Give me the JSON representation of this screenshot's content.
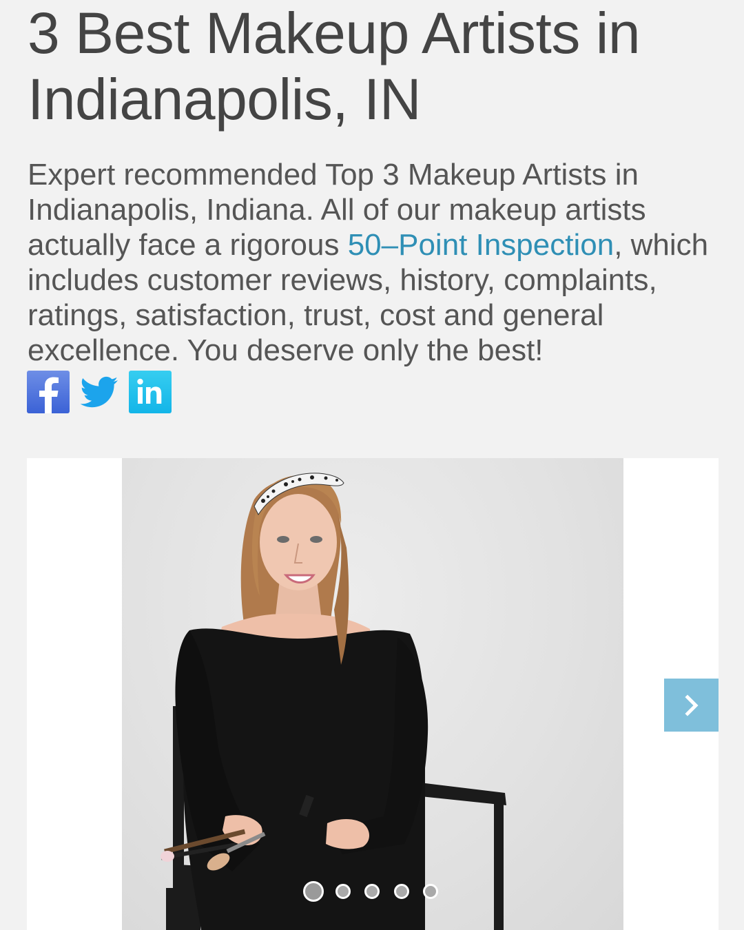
{
  "page": {
    "title": "3 Best Makeup Artists in Indianapolis, IN",
    "intro_before_link": "Expert recommended Top 3 Makeup Artists in Indianapolis, Indiana. All of our makeup artists actually face a rigorous ",
    "intro_link": "50–Point Inspection",
    "intro_after_link": ", which includes customer reviews, history, complaints, ratings, satisfaction, trust, cost and general excellence. You deserve only the best!"
  },
  "social": [
    {
      "name": "facebook",
      "icon": "facebook-icon",
      "color": "#4a6fdc"
    },
    {
      "name": "twitter",
      "icon": "twitter-icon",
      "color": "#1da1f2"
    },
    {
      "name": "linkedin",
      "icon": "linkedin-icon",
      "color": "#1ab7ea"
    }
  ],
  "slider": {
    "next_icon": "chevron-right-icon",
    "dot_count": 5,
    "active_dot": 1
  },
  "colors": {
    "background": "#f2f2f2",
    "link": "#2f8fb5",
    "next_button": "#7fbfdb"
  }
}
